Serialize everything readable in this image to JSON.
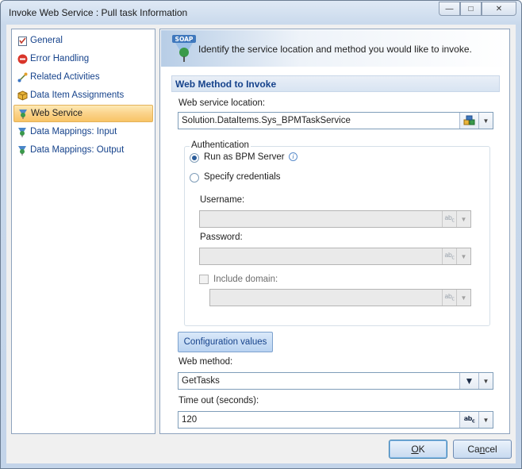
{
  "window": {
    "title": "Invoke Web Service : Pull task Information",
    "minimize_glyph": "—",
    "maximize_glyph": "□",
    "close_glyph": "✕"
  },
  "nav": {
    "items": [
      {
        "label": "General",
        "icon": "checklist-icon"
      },
      {
        "label": "Error Handling",
        "icon": "error-icon"
      },
      {
        "label": "Related Activities",
        "icon": "link-icon"
      },
      {
        "label": "Data Item Assignments",
        "icon": "cube-icon"
      },
      {
        "label": "Web Service",
        "icon": "soap-icon"
      },
      {
        "label": "Data Mappings: Input",
        "icon": "mapping-icon"
      },
      {
        "label": "Data Mappings: Output",
        "icon": "mapping-icon"
      }
    ],
    "selected_index": 4
  },
  "banner": {
    "icon_text": "SOAP",
    "text": "Identify the service location and method you would like to invoke."
  },
  "section": {
    "header": "Web Method to Invoke",
    "location_label": "Web service location:",
    "location_value": "Solution.DataItems.Sys_BPMTaskService",
    "auth": {
      "title": "Authentication",
      "run_as": "Run as BPM Server",
      "specify": "Specify credentials",
      "selected": "run_as",
      "username_label": "Username:",
      "username_value": "",
      "password_label": "Password:",
      "password_value": "",
      "include_domain_label": "Include domain:",
      "include_domain_checked": false,
      "domain_value": ""
    },
    "config_button": "Configuration values",
    "method_label": "Web method:",
    "method_value": "GetTasks",
    "timeout_label": "Time out (seconds):",
    "timeout_value": "120"
  },
  "buttons": {
    "ok_prefix": "",
    "ok_mnemonic": "O",
    "ok_rest": "K",
    "cancel_prefix": "Ca",
    "cancel_mnemonic": "n",
    "cancel_rest": "cel"
  },
  "colors": {
    "accent": "#15428b",
    "selected_bg": "#fbd38a"
  }
}
